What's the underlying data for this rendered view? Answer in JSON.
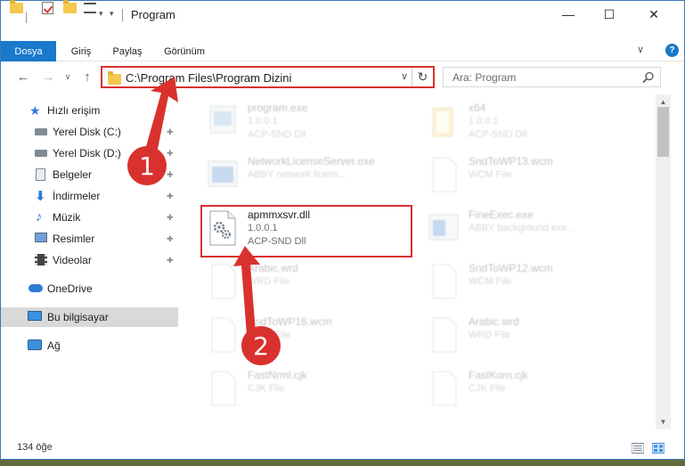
{
  "window": {
    "title": "Program",
    "minimize_glyph": "—",
    "maximize_glyph": "☐",
    "close_glyph": "✕"
  },
  "ribbon": {
    "tabs": [
      "Dosya",
      "Giriş",
      "Paylaş",
      "Görünüm"
    ],
    "expand_glyph": "∨",
    "help_glyph": "?"
  },
  "navigation": {
    "back_glyph": "←",
    "forward_glyph": "→",
    "recent_glyph": "∨",
    "up_glyph": "↑"
  },
  "address": {
    "path": "C:\\Program Files\\Program Dizini",
    "dropdown_glyph": "∨",
    "refresh_glyph": "↻"
  },
  "search": {
    "placeholder": "Ara: Program"
  },
  "sidebar": {
    "items": [
      {
        "label": "Hızlı erişim",
        "icon": "star-icon"
      },
      {
        "label": "Yerel Disk (C:)",
        "icon": "drive-icon"
      },
      {
        "label": "Yerel Disk (D:)",
        "icon": "drive-icon"
      },
      {
        "label": "Belgeler",
        "icon": "documents-icon"
      },
      {
        "label": "İndirmeler",
        "icon": "download-icon"
      },
      {
        "label": "Müzik",
        "icon": "music-icon"
      },
      {
        "label": "Resimler",
        "icon": "pictures-icon"
      },
      {
        "label": "Videolar",
        "icon": "video-icon"
      },
      {
        "label": "OneDrive",
        "icon": "cloud-icon"
      },
      {
        "label": "Bu bilgisayar",
        "icon": "computer-icon"
      },
      {
        "label": "Ağ",
        "icon": "network-icon"
      }
    ],
    "pin_glyph": "📌"
  },
  "files": [
    {
      "name": "program.exe",
      "line2": "1.0.0.1",
      "line3": "ACP-SND Dll"
    },
    {
      "name": "x64",
      "line2": "1.0.0.1",
      "line3": "ACP-SND Dll"
    },
    {
      "name": "NetworkLicenseServer.exe",
      "line2": "ABBY network licens...",
      "line3": ""
    },
    {
      "name": "SndToWP13.wcm",
      "line2": "WCM File",
      "line3": ""
    },
    {
      "name": "apmmxsvr.dll",
      "line2": "1.0.0.1",
      "line3": "ACP-SND Dll"
    },
    {
      "name": "FineExec.exe",
      "line2": "ABBY background exe...",
      "line3": ""
    },
    {
      "name": "Arabic.wrd",
      "line2": "WRD File",
      "line3": ""
    },
    {
      "name": "SndToWP12.wcm",
      "line2": "WCM File",
      "line3": ""
    },
    {
      "name": "SndToWP16.wcm",
      "line2": "WCM File",
      "line3": ""
    },
    {
      "name": "Arabic.wrd",
      "line2": "WRD File",
      "line3": ""
    },
    {
      "name": "FastNrml.cjk",
      "line2": "CJK File",
      "line3": ""
    },
    {
      "name": "FastKorn.cjk",
      "line2": "CJK File",
      "line3": ""
    }
  ],
  "status": {
    "item_count": "134 öğe"
  },
  "callouts": [
    "1",
    "2"
  ],
  "colors": {
    "accent": "#1979ca",
    "highlight": "#d9312d"
  }
}
